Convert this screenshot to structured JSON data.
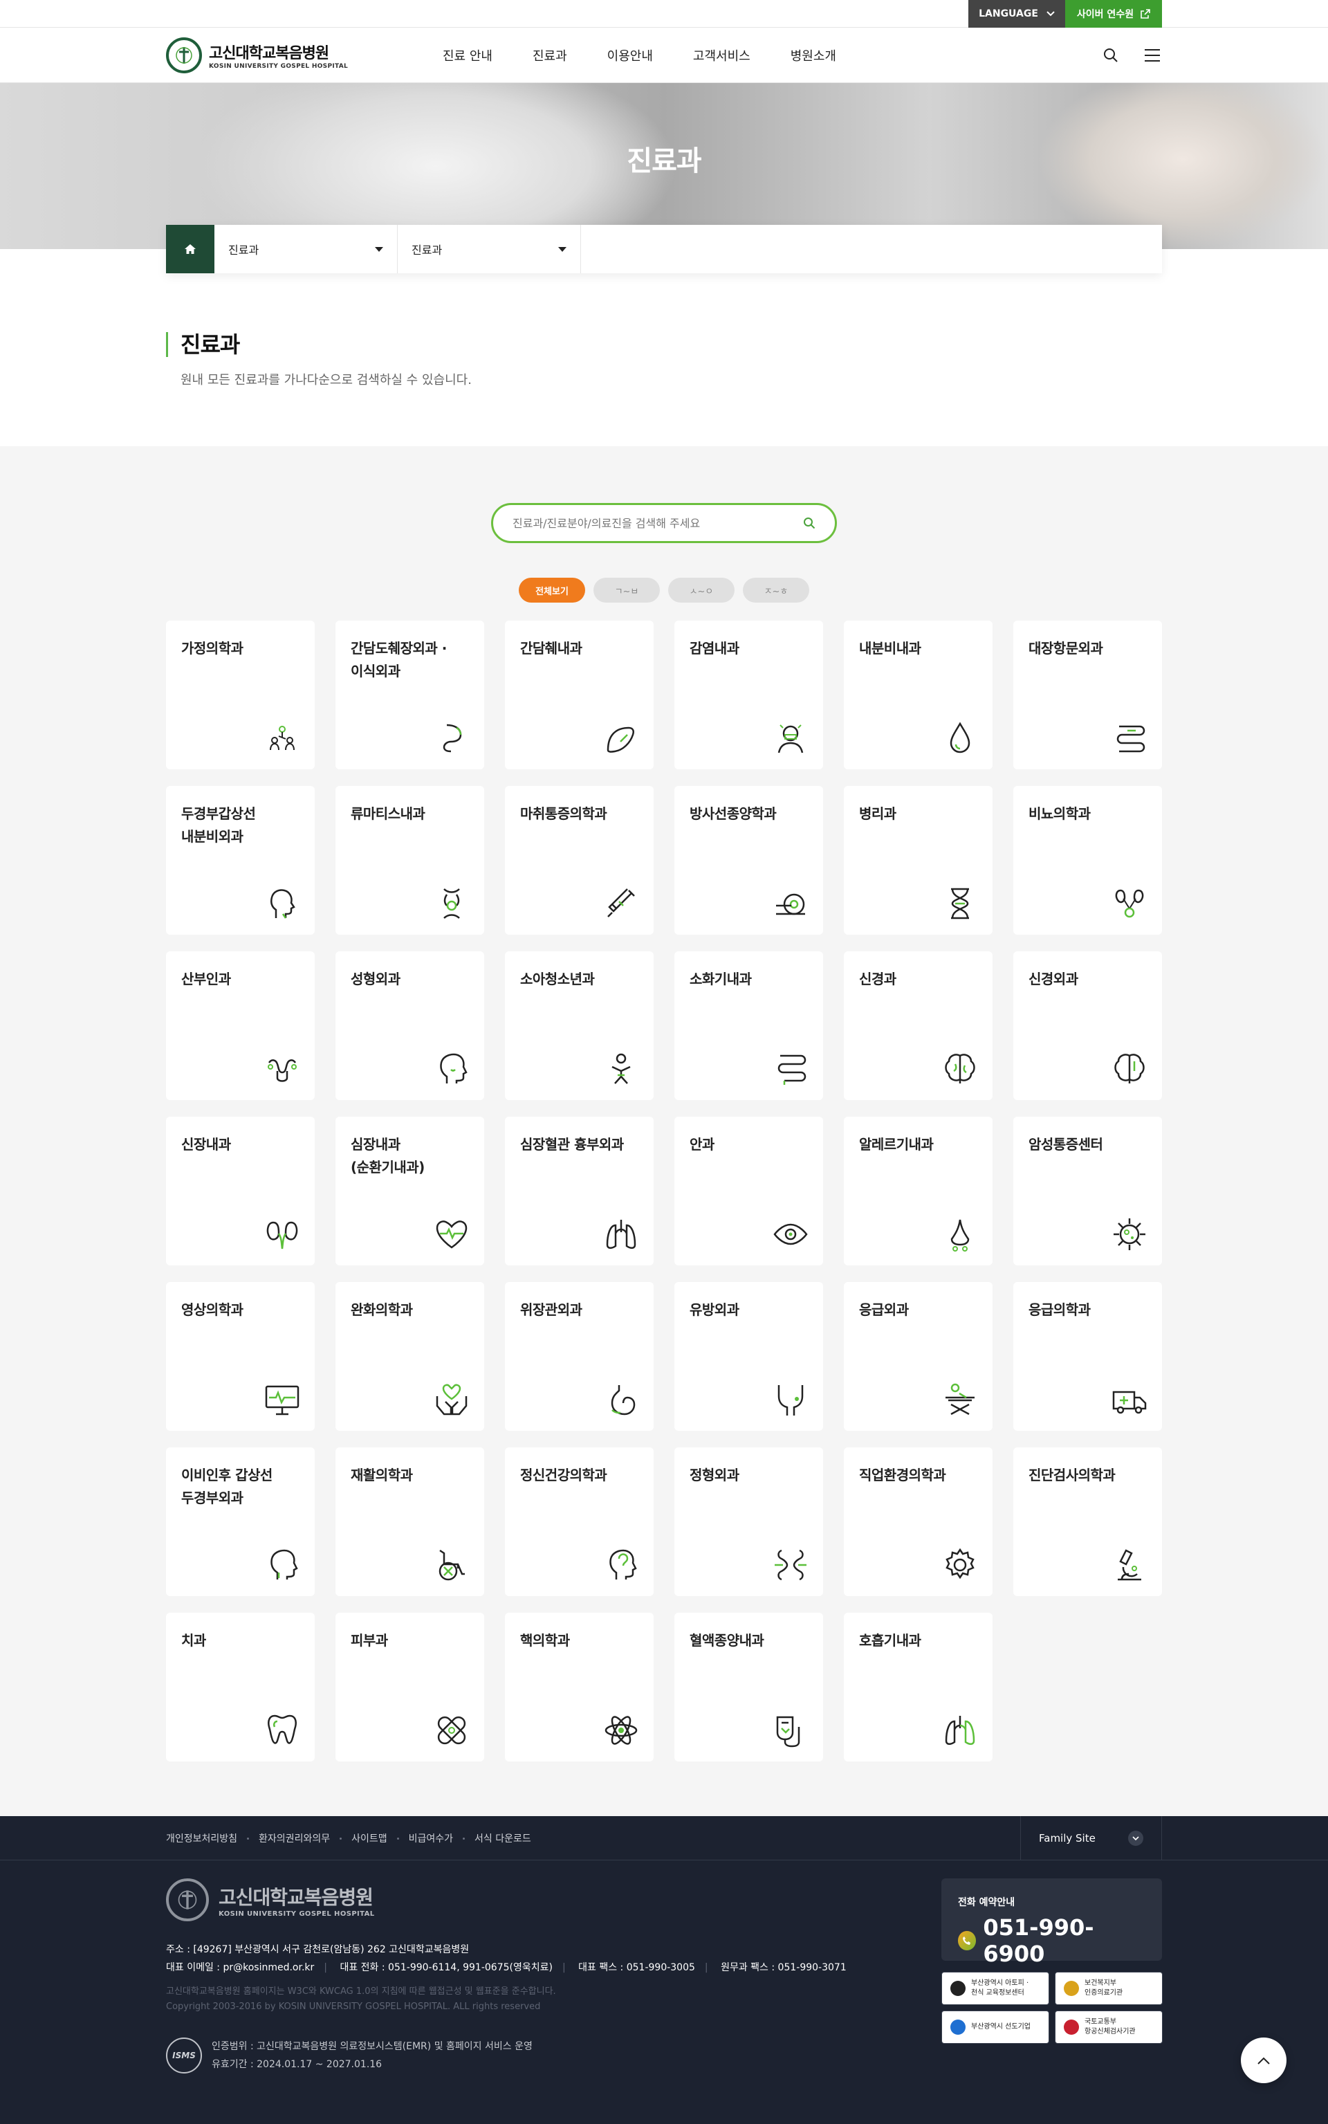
{
  "utility": {
    "language_label": "LANGUAGE",
    "cyber_label": "사이버 연수원"
  },
  "header": {
    "logo_title": "고신대학교복음병원",
    "logo_sub": "KOSIN UNIVERSITY GOSPEL HOSPITAL",
    "nav": [
      "진료 안내",
      "진료과",
      "이용안내",
      "고객서비스",
      "병원소개"
    ]
  },
  "hero": {
    "title": "진료과"
  },
  "breadcrumb": {
    "level1": "진료과",
    "level2": "진료과"
  },
  "page": {
    "title": "진료과",
    "description": "원내 모든 진료과를 가나다순으로 검색하실 수 있습니다."
  },
  "search": {
    "placeholder": "진료과/진료분야/의료진을 검색해 주세요"
  },
  "filters": [
    "전체보기",
    "ㄱ~ㅂ",
    "ㅅ~ㅇ",
    "ㅈ~ㅎ"
  ],
  "departments": [
    {
      "name": "가정의학과",
      "icon": "family-icon"
    },
    {
      "name": "간담도췌장외과 ·\n이식외과",
      "icon": "digestive-organ-icon"
    },
    {
      "name": "간담췌내과",
      "icon": "liver-icon"
    },
    {
      "name": "감염내과",
      "icon": "masked-doctor-icon"
    },
    {
      "name": "내분비내과",
      "icon": "drop-icon"
    },
    {
      "name": "대장항문외과",
      "icon": "intestine-icon"
    },
    {
      "name": "두경부갑상선\n내분비외과",
      "icon": "head-neck-icon"
    },
    {
      "name": "류마티스내과",
      "icon": "joint-icon"
    },
    {
      "name": "마취통증의학과",
      "icon": "syringe-icon"
    },
    {
      "name": "방사선종양학과",
      "icon": "scanner-icon"
    },
    {
      "name": "병리과",
      "icon": "dna-icon"
    },
    {
      "name": "비뇨의학과",
      "icon": "kidney-bladder-icon"
    },
    {
      "name": "산부인과",
      "icon": "uterus-icon"
    },
    {
      "name": "성형외과",
      "icon": "face-icon"
    },
    {
      "name": "소아청소년과",
      "icon": "child-icon"
    },
    {
      "name": "소화기내과",
      "icon": "stomach-intestine-icon"
    },
    {
      "name": "신경과",
      "icon": "brain-icon"
    },
    {
      "name": "신경외과",
      "icon": "brain-surgery-icon"
    },
    {
      "name": "신장내과",
      "icon": "kidneys-icon"
    },
    {
      "name": "심장내과\n(순환기내과)",
      "icon": "heart-pulse-icon"
    },
    {
      "name": "심장혈관 흉부외과",
      "icon": "lungs-icon"
    },
    {
      "name": "안과",
      "icon": "eye-icon"
    },
    {
      "name": "알레르기내과",
      "icon": "nose-icon"
    },
    {
      "name": "암성통증센터",
      "icon": "virus-icon"
    },
    {
      "name": "영상의학과",
      "icon": "monitor-icon"
    },
    {
      "name": "완화의학과",
      "icon": "care-hands-icon"
    },
    {
      "name": "위장관외과",
      "icon": "stomach-icon"
    },
    {
      "name": "유방외과",
      "icon": "breast-icon"
    },
    {
      "name": "응급외과",
      "icon": "stretcher-icon"
    },
    {
      "name": "응급의학과",
      "icon": "ambulance-icon"
    },
    {
      "name": "이비인후 갑상선\n두경부외과",
      "icon": "ent-icon"
    },
    {
      "name": "재활의학과",
      "icon": "wheelchair-icon"
    },
    {
      "name": "정신건강의학과",
      "icon": "mind-icon"
    },
    {
      "name": "정형외과",
      "icon": "bone-icon"
    },
    {
      "name": "직업환경의학과",
      "icon": "gear-icon"
    },
    {
      "name": "진단검사의학과",
      "icon": "microscope-icon"
    },
    {
      "name": "치과",
      "icon": "tooth-icon"
    },
    {
      "name": "피부과",
      "icon": "bandage-icon"
    },
    {
      "name": "핵의학과",
      "icon": "atom-icon"
    },
    {
      "name": "혈액종양내과",
      "icon": "blood-bag-icon"
    },
    {
      "name": "호흡기내과",
      "icon": "lung-icon"
    }
  ],
  "footer": {
    "links": [
      "개인정보처리방침",
      "환자의권리와의무",
      "사이트맵",
      "비급여수가",
      "서식 다운로드"
    ],
    "family_site": "Family Site",
    "logo_title": "고신대학교복음병원",
    "logo_sub": "KOSIN UNIVERSITY GOSPEL HOSPITAL",
    "address": "주소 : [49267] 부산광역시 서구 감천로(암남동) 262 고신대학교복음병원",
    "email": "대표 이메일 : pr@kosinmed.or.kr",
    "phone": "대표 전화 : 051-990-6114, 991-0675(영욱치료)",
    "fax": "대표 팩스 : 051-990-3005",
    "fax2": "원무과 팩스 : 051-990-3071",
    "accessibility": "고신대학교복음병원 홈페이지는 W3C와 KWCAG 1.0의 지침에 따른 웹접근성 및 웹표준을 준수합니다.",
    "copyright": "Copyright 2003-2016 by KOSIN UNIVERSITY GOSPEL HOSPITAL. ALL rights reserved",
    "isms_badge": "ISMS",
    "isms_scope": "인증범위 : 고신대학교복음병원 의료정보시스템(EMR) 및 홈페이지 서비스 운영",
    "isms_period": "유효기간 : 2024.01.17 ~ 2027.01.16",
    "call_label": "전화 예약안내",
    "call_number": "051-990-6900",
    "certs": [
      {
        "text": "부산광역시 아토피 ·\n천식 교육정보센터",
        "color": "#222222"
      },
      {
        "text": "보건복지부\n인증의료기관",
        "color": "#d9a21b"
      },
      {
        "text": "부산광역시 선도기업",
        "color": "#1f6fd1"
      },
      {
        "text": "국토교통부\n항공신체검사기관",
        "color": "#c8202f"
      }
    ]
  },
  "colors": {
    "brand_green": "#3d9e2f",
    "dark_green": "#1f4a35",
    "accent_orange": "#f07b1d",
    "footer_bg": "#1c2230"
  }
}
